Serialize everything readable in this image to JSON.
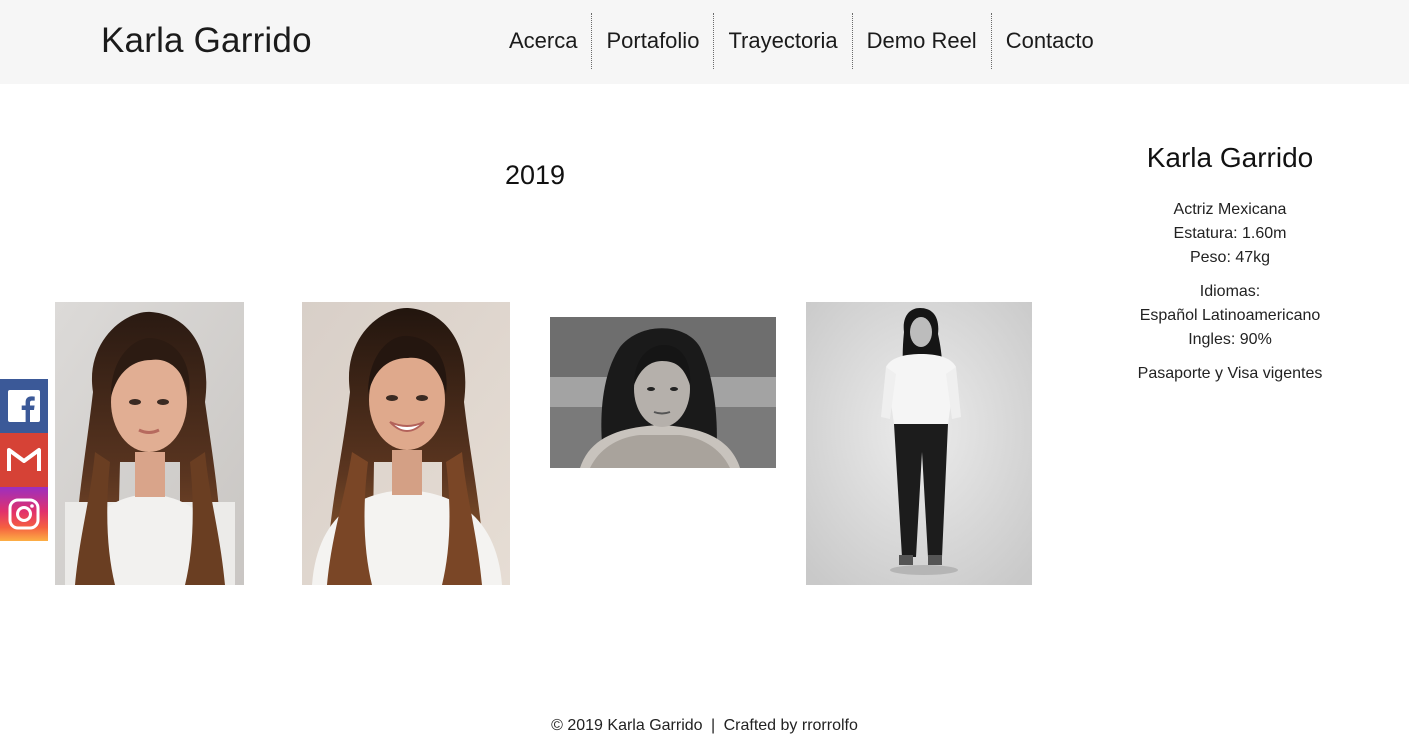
{
  "header": {
    "brand": "Karla Garrido",
    "nav": [
      {
        "label": "Acerca"
      },
      {
        "label": "Portafolio"
      },
      {
        "label": "Trayectoria"
      },
      {
        "label": "Demo Reel"
      },
      {
        "label": "Contacto"
      }
    ]
  },
  "main": {
    "year": "2019",
    "photos": [
      {
        "description": "color-headshot-serious",
        "icon": "photo"
      },
      {
        "description": "color-headshot-smiling",
        "icon": "photo"
      },
      {
        "description": "bw-portrait",
        "icon": "photo"
      },
      {
        "description": "bw-full-body",
        "icon": "photo"
      }
    ]
  },
  "profile": {
    "name": "Karla Garrido",
    "line1": "Actriz Mexicana",
    "line2": "Estatura: 1.60m",
    "line3": "Peso: 47kg",
    "languages_label": "Idiomas:",
    "language1": "Español Latinoamericano",
    "language2": "Ingles: 90%",
    "documents": "Pasaporte y Visa vigentes"
  },
  "social": {
    "facebook_icon": "facebook-icon",
    "gmail_icon": "gmail-icon",
    "instagram_icon": "instagram-icon",
    "colors": {
      "facebook": "#3b5998",
      "gmail": "#d64236"
    }
  },
  "footer": {
    "copyright": "© 2019 Karla Garrido",
    "separator": "|",
    "credit": "Crafted by rrorrolfo"
  }
}
